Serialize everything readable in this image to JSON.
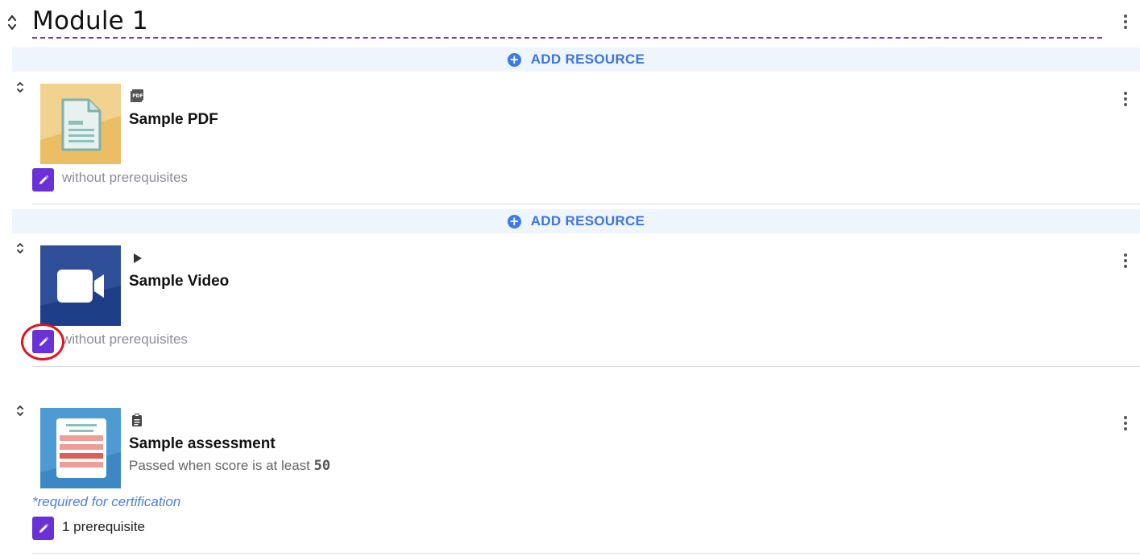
{
  "module": {
    "title": "Module 1"
  },
  "add_resource": {
    "label": "ADD RESOURCE",
    "icon": "plus-circle-icon"
  },
  "resources": [
    {
      "title": "Sample PDF",
      "type_icon": "pdf-icon",
      "thumbnail": "document-thumbnail",
      "prerequisites": "without prerequisites"
    },
    {
      "title": "Sample Video",
      "type_icon": "play-icon",
      "thumbnail": "video-camera-thumbnail",
      "prerequisites": "without prerequisites"
    },
    {
      "title": "Sample assessment",
      "type_icon": "clipboard-icon",
      "thumbnail": "assessment-thumbnail",
      "subtitle_prefix": "Passed when score is at least",
      "subtitle_score": "50",
      "required_note": "*required for certification",
      "prerequisites": "1 prerequisite"
    }
  ],
  "colors": {
    "accent_purple": "#6a31d6",
    "link_blue": "#3f74dc",
    "add_bar_bg": "#eef5fd",
    "highlight_red": "#e0141e"
  }
}
